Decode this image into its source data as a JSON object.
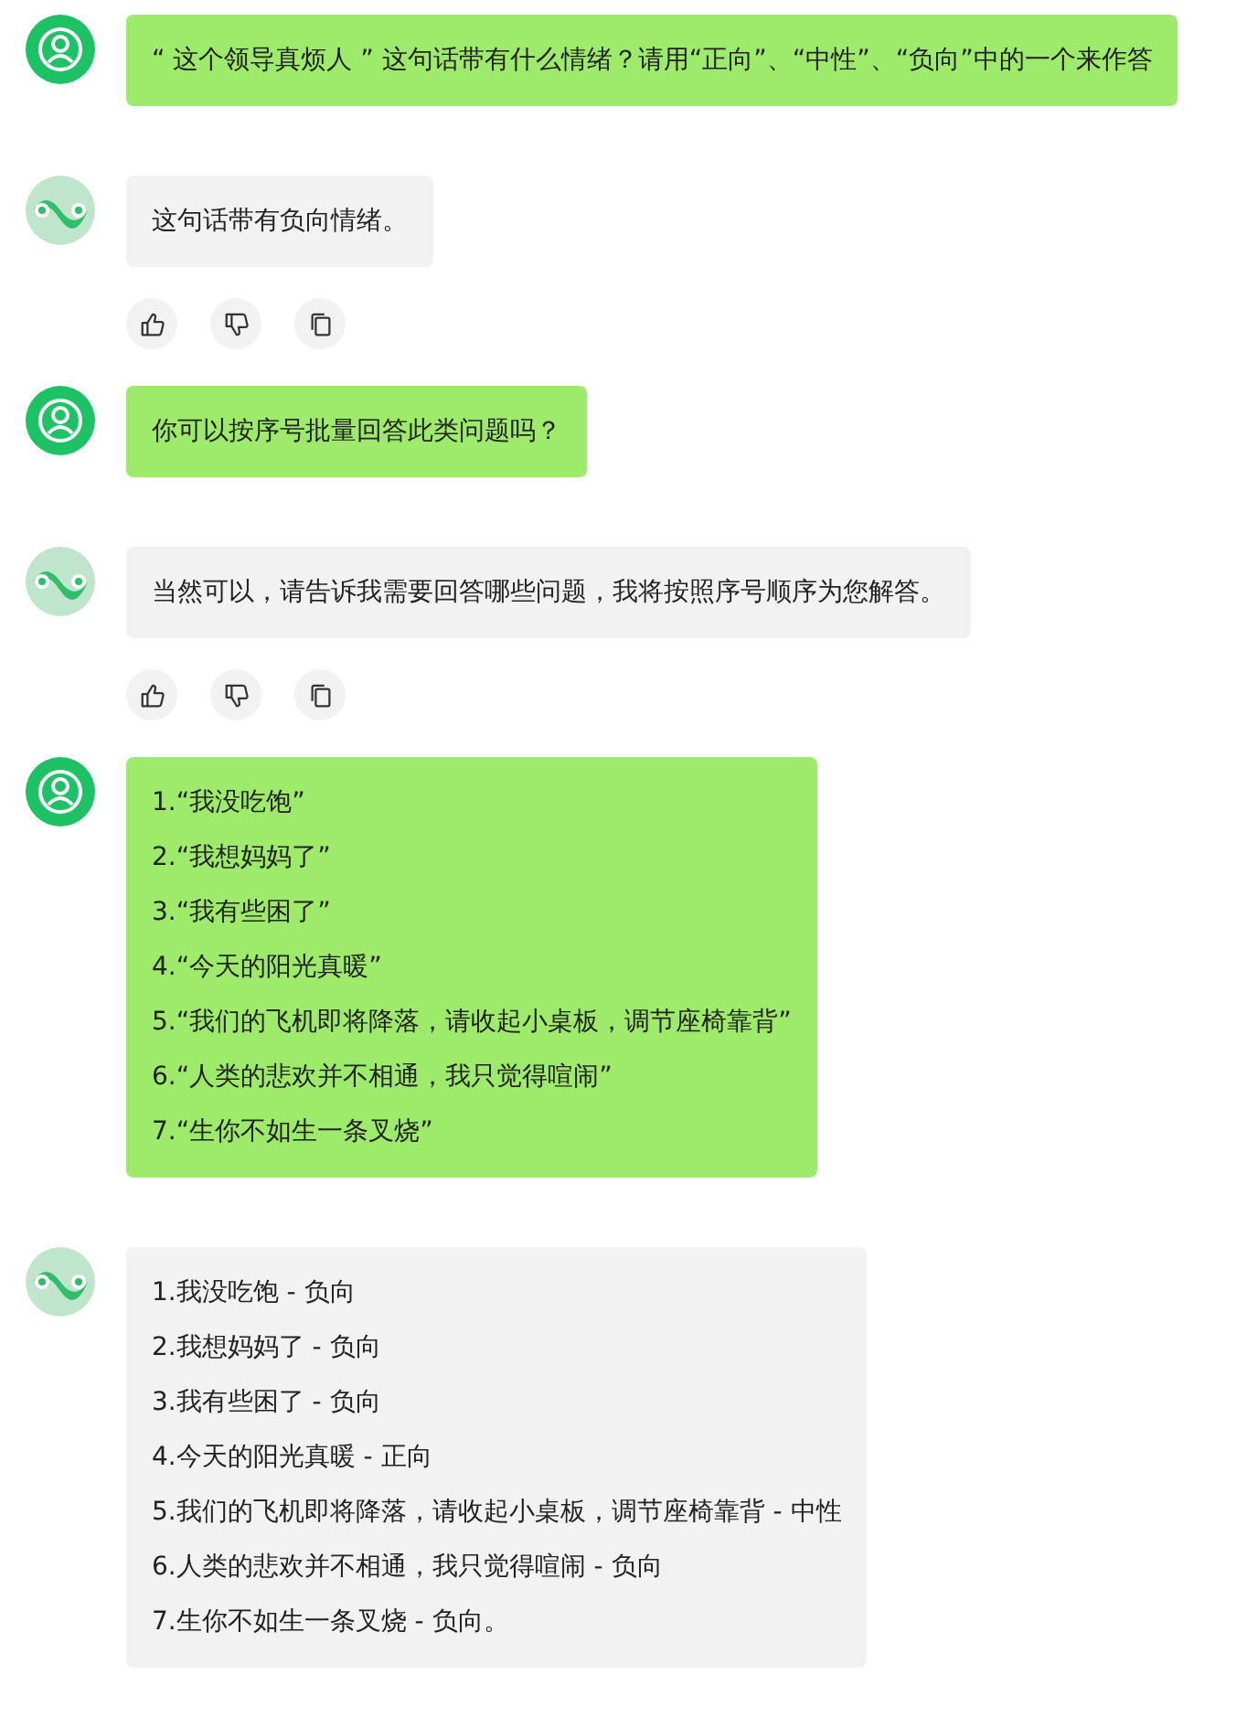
{
  "messages": [
    {
      "kind": "user",
      "lines": [
        "“ 这个领导真烦人 ” 这句话带有什么情绪？请用“正向”、“中性”、“负向”中的一个来作答"
      ],
      "actions": false
    },
    {
      "kind": "bot",
      "lines": [
        "这句话带有负向情绪。"
      ],
      "actions": true
    },
    {
      "kind": "user",
      "lines": [
        "你可以按序号批量回答此类问题吗？"
      ],
      "actions": false
    },
    {
      "kind": "bot",
      "lines": [
        "当然可以，请告诉我需要回答哪些问题，我将按照序号顺序为您解答。"
      ],
      "actions": true
    },
    {
      "kind": "user",
      "lines": [
        "1.“我没吃饱”",
        "2.“我想妈妈了”",
        "3.“我有些困了”",
        "4.“今天的阳光真暖”",
        "5.“我们的飞机即将降落，请收起小桌板，调节座椅靠背”",
        "6.“人类的悲欢并不相通，我只觉得喧闹”",
        "7.“生你不如生一条叉烧”"
      ],
      "actions": false
    },
    {
      "kind": "bot",
      "lines": [
        "1.我没吃饱 - 负向",
        "2.我想妈妈了 - 负向",
        "3.我有些困了 - 负向",
        "4.今天的阳光真暖 - 正向",
        "5.我们的飞机即将降落，请收起小桌板，调节座椅靠背 - 中性",
        "6.人类的悲欢并不相通，我只觉得喧闹 - 负向",
        "7.生你不如生一条叉烧 - 负向。"
      ],
      "actions": false
    }
  ]
}
